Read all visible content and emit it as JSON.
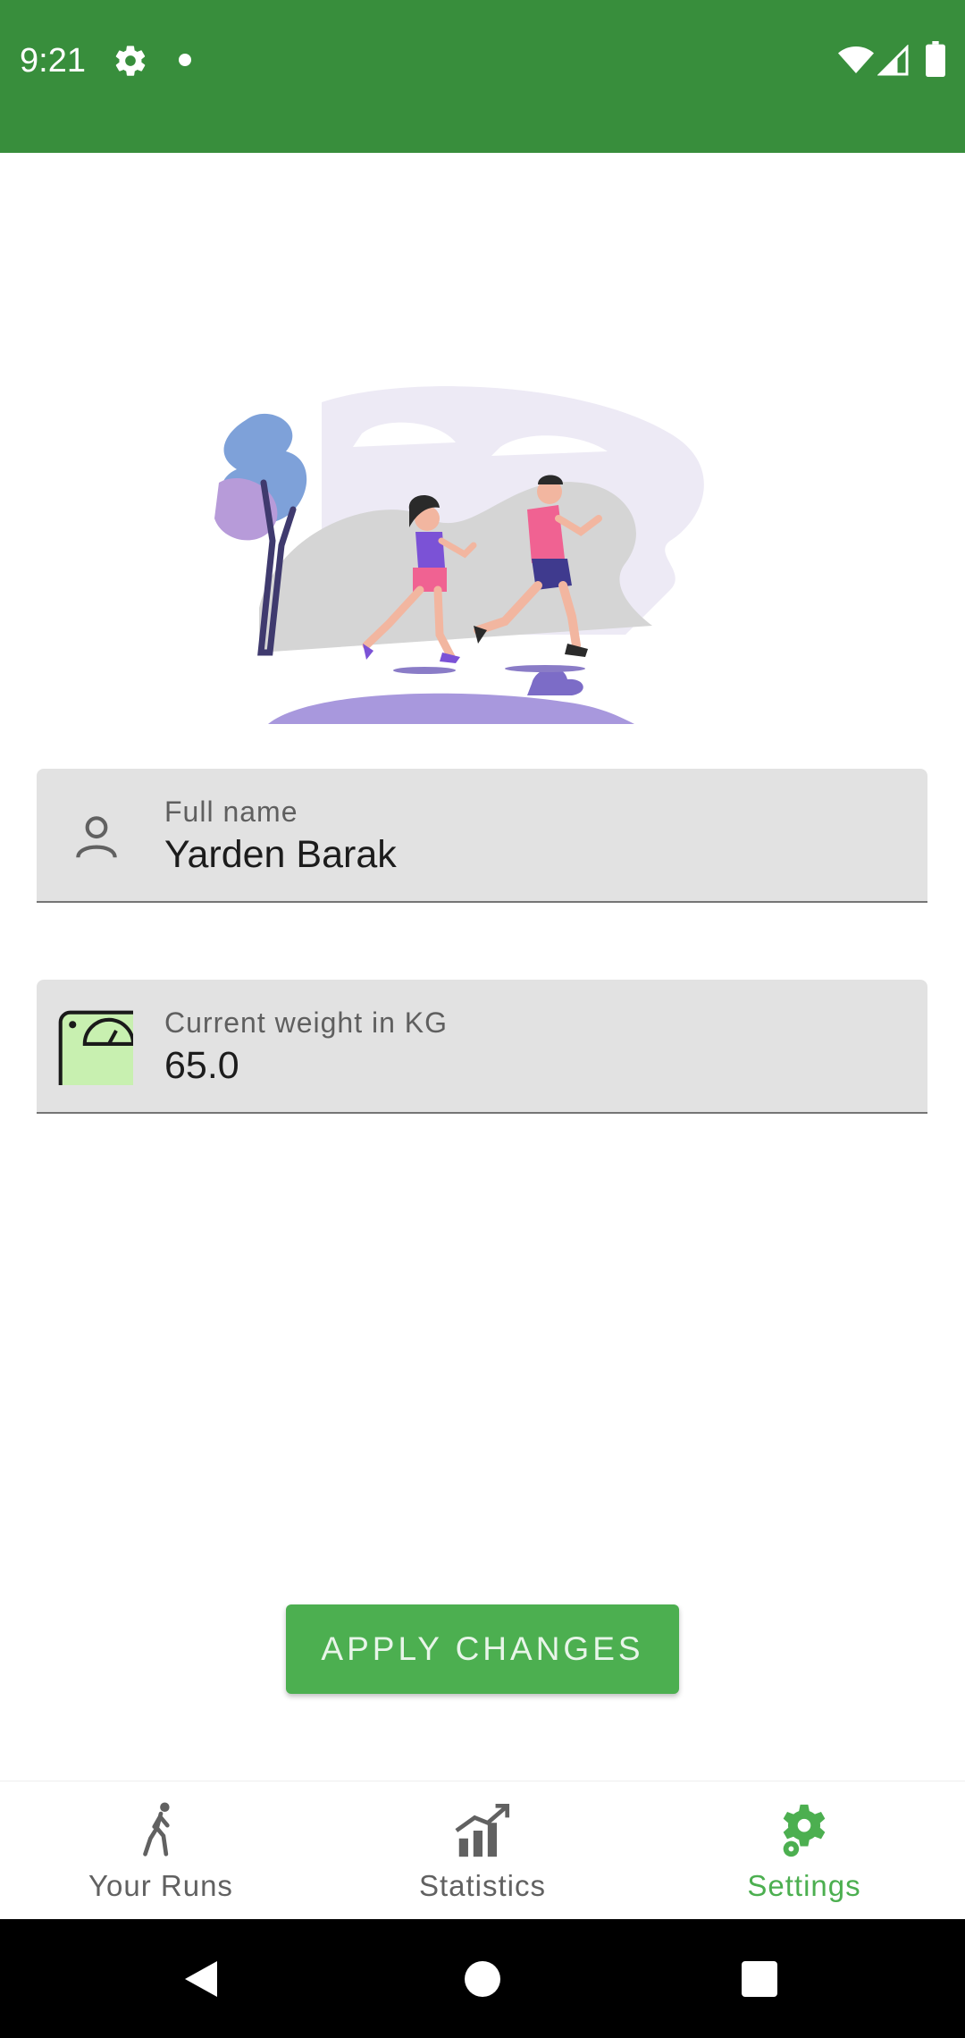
{
  "status_bar": {
    "time": "9:21",
    "icons": [
      "gear-icon",
      "dot-icon",
      "wifi-icon",
      "signal-icon",
      "battery-icon"
    ]
  },
  "illustration": {
    "name": "two-runners-illustration"
  },
  "form": {
    "full_name": {
      "label": "Full name",
      "value": "Yarden Barak",
      "icon": "person-icon"
    },
    "weight": {
      "label": "Current weight in KG",
      "value": "65.0",
      "icon": "scale-icon"
    }
  },
  "apply_button": {
    "label": "APPLY CHANGES"
  },
  "bottom_nav": {
    "items": [
      {
        "label": "Your Runs",
        "icon": "runner-icon",
        "active": false
      },
      {
        "label": "Statistics",
        "icon": "chart-icon",
        "active": false
      },
      {
        "label": "Settings",
        "icon": "gear-icon",
        "active": true
      }
    ]
  },
  "system_nav": {
    "icons": [
      "back-icon",
      "home-icon",
      "recents-icon"
    ]
  },
  "colors": {
    "status_bar": "#388e3c",
    "accent": "#4caf50",
    "field_background": "#e2e2e2"
  }
}
